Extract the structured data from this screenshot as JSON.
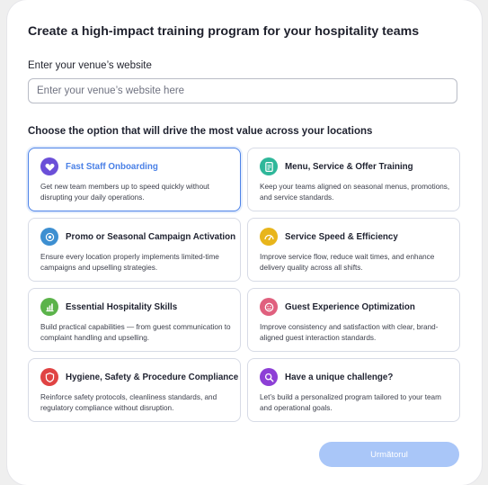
{
  "form": {
    "title": "Create a high-impact training program for your hospitality teams",
    "website_label": "Enter your venue’s website",
    "website_placeholder": "Enter your venue’s website here",
    "website_value": "",
    "options_heading": "Choose the option that will drive the most value across your locations",
    "next_label": "Următorul"
  },
  "options": [
    {
      "title": "Fast Staff Onboarding",
      "description": "Get new team members up to speed quickly without disrupting your daily operations.",
      "icon": "heart-badge-icon",
      "color": "#6b4fd8",
      "selected": true
    },
    {
      "title": "Menu, Service & Offer Training",
      "description": "Keep your teams aligned on seasonal menus, promotions, and service standards.",
      "icon": "menu-document-icon",
      "color": "#2fb79a",
      "selected": false
    },
    {
      "title": "Promo or Seasonal Campaign Activation",
      "description": "Ensure every location properly implements limited-time campaigns and upselling strategies.",
      "icon": "campaign-spiral-icon",
      "color": "#3d8fd1",
      "selected": false
    },
    {
      "title": "Service Speed & Efficiency",
      "description": "Improve service flow, reduce wait times, and enhance delivery quality across all shifts.",
      "icon": "speedometer-icon",
      "color": "#e8b51b",
      "selected": false
    },
    {
      "title": "Essential Hospitality Skills",
      "description": "Build practical capabilities — from guest communication to complaint handling and upselling.",
      "icon": "skills-chart-icon",
      "color": "#5bb34a",
      "selected": false
    },
    {
      "title": "Guest Experience Optimization",
      "description": "Improve consistency and satisfaction with clear, brand-aligned guest interaction standards.",
      "icon": "guest-smile-icon",
      "color": "#e0607e",
      "selected": false
    },
    {
      "title": "Hygiene, Safety & Procedure Compliance",
      "description": "Reinforce safety protocols, cleanliness standards, and regulatory compliance without disruption.",
      "icon": "shield-icon",
      "color": "#e04343",
      "selected": false
    },
    {
      "title": "Have a unique challenge?",
      "description": "Let’s build a personalized program tailored to your team and operational goals.",
      "icon": "search-icon",
      "color": "#8d3fd6",
      "selected": false
    }
  ]
}
